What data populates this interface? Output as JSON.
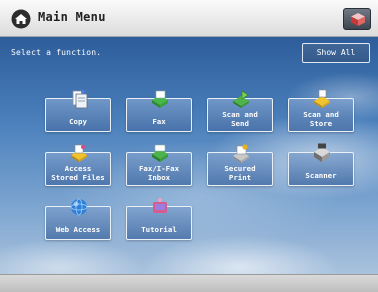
{
  "header": {
    "title": "Main Menu",
    "home_icon": "home-icon",
    "corner_icon": "settings-cube-icon"
  },
  "main": {
    "prompt": "Select a function.",
    "show_all_label": "Show All",
    "functions": [
      {
        "label": "Copy",
        "icon": "copy-icon"
      },
      {
        "label": "Fax",
        "icon": "fax-icon"
      },
      {
        "label": "Scan and\nSend",
        "icon": "scan-send-icon"
      },
      {
        "label": "Scan and\nStore",
        "icon": "scan-store-icon"
      },
      {
        "label": "Access\nStored Files",
        "icon": "stored-files-icon"
      },
      {
        "label": "Fax/I-Fax\nInbox",
        "icon": "fax-inbox-icon"
      },
      {
        "label": "Secured\nPrint",
        "icon": "secured-print-icon"
      },
      {
        "label": "Scanner",
        "icon": "scanner-icon"
      },
      {
        "label": "Web Access",
        "icon": "web-access-icon"
      },
      {
        "label": "Tutorial",
        "icon": "tutorial-icon"
      }
    ]
  },
  "colors": {
    "tile_fill": "#5f8bc0",
    "tile_border": "#e9f0f7",
    "title_bar": "#e6e6e6",
    "sky": "#4a7fbb"
  }
}
